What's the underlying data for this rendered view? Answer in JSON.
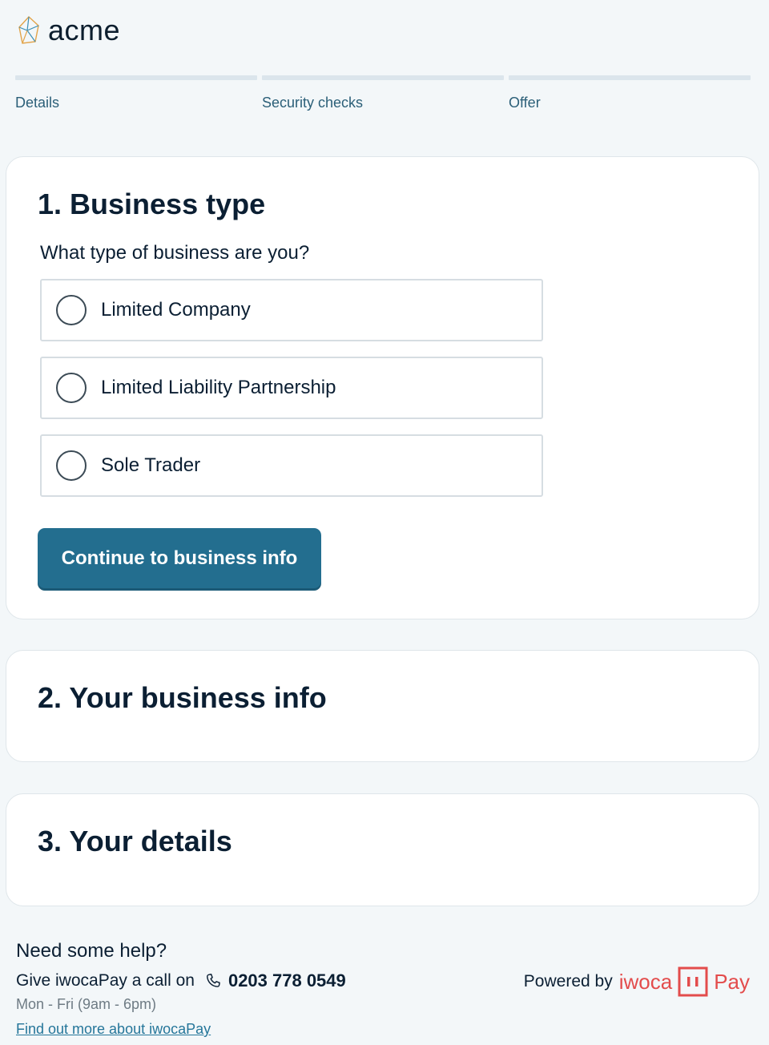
{
  "header": {
    "logo_text": "acme",
    "logo_icon": "polygon-logo-icon"
  },
  "steps": [
    {
      "label": "Details"
    },
    {
      "label": "Security checks"
    },
    {
      "label": "Offer"
    }
  ],
  "section1": {
    "title": "1. Business type",
    "question": "What type of business are you?",
    "options": [
      {
        "label": "Limited Company",
        "selected": false
      },
      {
        "label": "Limited Liability Partnership",
        "selected": false
      },
      {
        "label": "Sole Trader",
        "selected": false
      }
    ],
    "continue_label": "Continue to business info"
  },
  "section2": {
    "title": "2. Your business info"
  },
  "section3": {
    "title": "3. Your details"
  },
  "footer": {
    "help_title": "Need some help?",
    "call_text": "Give iwocaPay a call on",
    "phone_icon": "phone-icon",
    "phone": "0203 778 0549",
    "hours": "Mon - Fri (9am - 6pm)",
    "link_text": "Find out more about iwocaPay",
    "powered_by": "Powered by",
    "brand_name": "iwoca",
    "brand_suffix": "Pay"
  },
  "colors": {
    "accent": "#236e8f",
    "brand": "#e34c4c",
    "background": "#f3f7f9"
  }
}
